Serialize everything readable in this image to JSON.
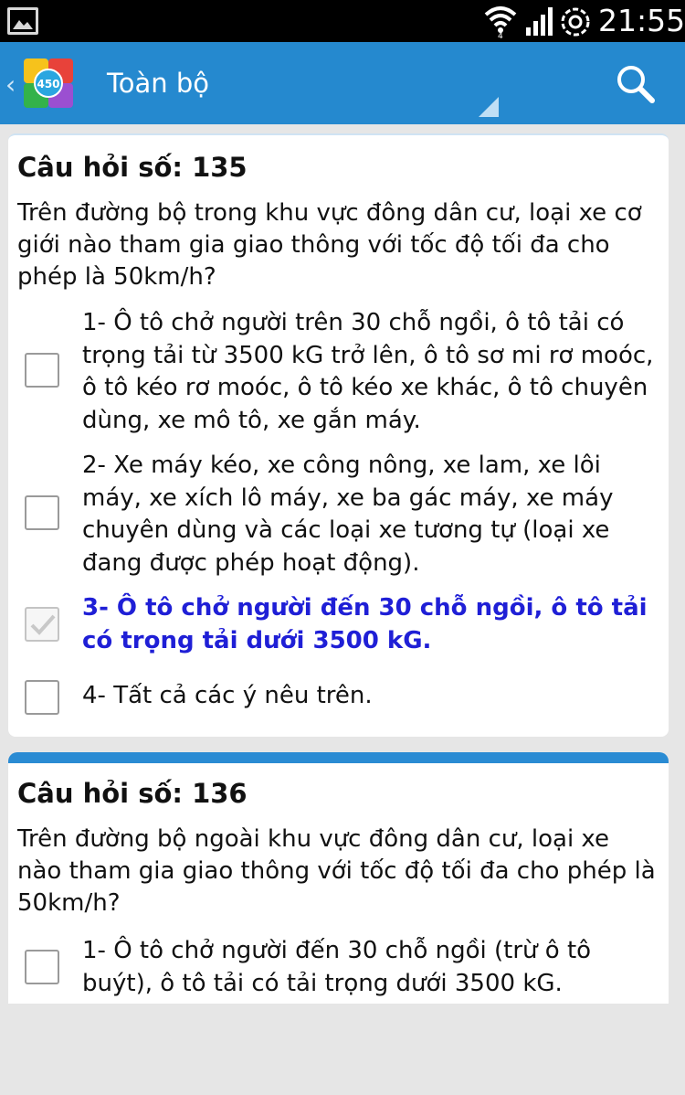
{
  "status_bar": {
    "time": "21:55",
    "icons": [
      "gallery-icon",
      "wifi-icon",
      "signal-icon",
      "sync-icon"
    ]
  },
  "action_bar": {
    "title": "Toàn bộ",
    "logo_text": "450",
    "icons": [
      "back-icon",
      "app-logo",
      "search-icon"
    ],
    "accent_color": "#2589cf"
  },
  "questions": [
    {
      "title": "Câu hỏi số: 135",
      "text": "Trên đường bộ trong khu vực đông dân cư, loại xe cơ giới nào tham gia giao thông với tốc độ tối đa cho phép là 50km/h?",
      "options": [
        {
          "label": "1- Ô tô chở người trên 30 chỗ ngồi, ô tô tải có trọng tải từ 3500 kG trở lên, ô tô sơ mi rơ moóc, ô tô kéo rơ moóc, ô tô kéo xe khác, ô tô chuyên dùng, xe mô tô, xe gắn máy.",
          "checked": false
        },
        {
          "label": "2- Xe máy kéo, xe công nông, xe lam, xe lôi máy, xe xích lô máy, xe ba gác máy, xe máy chuyên dùng và các loại xe tương tự (loại xe đang được phép hoạt động).",
          "checked": false
        },
        {
          "label": "3- Ô tô chở người đến 30 chỗ ngồi, ô tô tải có trọng tải dưới 3500 kG.",
          "checked": true,
          "correct": true
        },
        {
          "label": "4- Tất cả các ý nêu trên.",
          "checked": false
        }
      ]
    },
    {
      "title": "Câu hỏi số: 136",
      "text": "Trên đường bộ ngoài khu vực đông dân cư, loại xe nào tham gia giao thông với tốc độ tối đa cho phép là 50km/h?",
      "options": [
        {
          "label": "1- Ô tô chở người đến 30 chỗ ngồi (trừ ô tô buýt), ô tô tải có tải trọng dưới 3500 kG.",
          "checked": false
        }
      ]
    }
  ],
  "colors": {
    "correct_answer": "#1f1fd6",
    "card_header": "#2a8bd3",
    "background": "#e6e6e6"
  }
}
